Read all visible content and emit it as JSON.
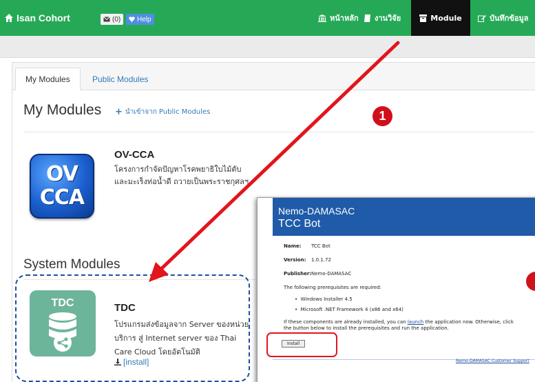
{
  "navbar": {
    "brand": "Isan Cohort",
    "mail_count": "(0)",
    "help_label": "Help",
    "items": [
      {
        "label": "หน้าหลัก",
        "icon": "institution-icon"
      },
      {
        "label": "งานวิจัย",
        "icon": "book-icon"
      },
      {
        "label": "Module",
        "icon": "archive-icon",
        "active": true
      },
      {
        "label": "บันทึกข้อมูล",
        "icon": "edit-icon"
      }
    ]
  },
  "tabs": [
    "My Modules",
    "Public Modules"
  ],
  "my_modules": {
    "heading": "My Modules",
    "import_link": "นำเข้าจาก Public Modules",
    "items": [
      {
        "icon_text_line1": "OV",
        "icon_text_line2": "CCA",
        "title": "OV-CCA",
        "description": "โครงการกำจัดปัญหาโรคพยาธิใบไม้ตับและมะเร็งท่อน้ำดี ถวายเป็นพระราชกุศลฯ"
      }
    ]
  },
  "system_modules": {
    "heading": "System Modules",
    "items": [
      {
        "icon_text": "TDC",
        "title": "TDC",
        "description": "โปรแกรมส่งข้อมูลจาก Server ของหน่วยบริการ สู่ Internet server ของ Thai Care Cloud โดยอัตโนมัติ",
        "install_label": "[install]"
      }
    ]
  },
  "installer": {
    "header_line1": "Nemo-DAMASAC",
    "header_line2": "TCC Bot",
    "name_label": "Name:",
    "name_value": "TCC Bot",
    "version_label": "Version:",
    "version_value": "1.0.1.72",
    "publisher_label": "Publisher:",
    "publisher_value": "Nemo-DAMASAC",
    "prereq_text": "The following prerequisites are required:",
    "prereqs": [
      "Windows Installer 4.5",
      "Microsoft .NET Framework 4 (x86 and x64)"
    ],
    "note_part1": "If these components are already installed, you can ",
    "note_link": "launch",
    "note_part2": " the application now. Otherwise, click the button below to install the prerequisites and run the application.",
    "install_button": "Install",
    "support_link": "Nemo-DAMASAC Customer Support"
  },
  "annotation": {
    "step_number": "1",
    "colors": {
      "arrow": "#e3141c",
      "dashed_box": "#1f4e9e",
      "navbar": "#25a957"
    }
  }
}
